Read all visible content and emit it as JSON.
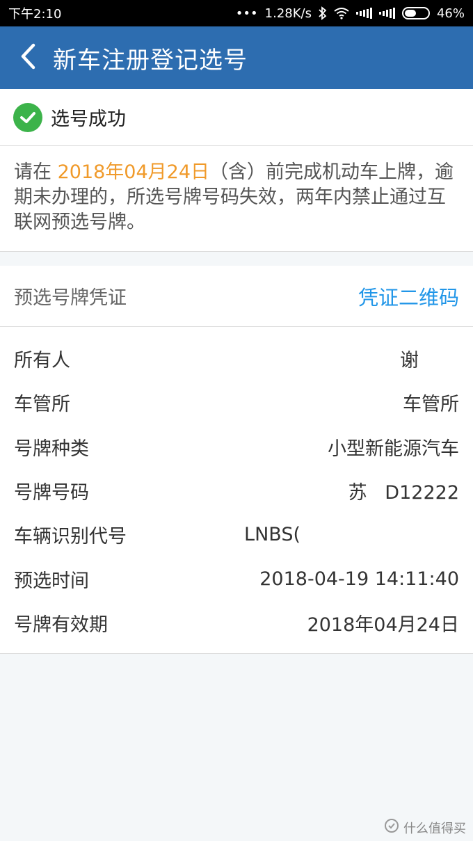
{
  "status_bar": {
    "time": "下午2:10",
    "dots": "•••",
    "speed": "1.28K/s",
    "battery_percent": "46%"
  },
  "app_bar": {
    "title": "新车注册登记选号"
  },
  "success": {
    "text": "选号成功"
  },
  "notice": {
    "prefix": "请在 ",
    "date": "2018年04月24日",
    "suffix": "（含）前完成机动车上牌，逾期未办理的，所选号牌号码失效，两年内禁止通过互联网预选号牌。"
  },
  "voucher": {
    "title": "预选号牌凭证",
    "qr_link": "凭证二维码"
  },
  "info_rows": [
    {
      "label": "所有人",
      "value": "谢"
    },
    {
      "label": "车管所",
      "value": "车管所"
    },
    {
      "label": "号牌种类",
      "value": "小型新能源汽车"
    },
    {
      "label": "号牌号码",
      "value": "苏   D12222"
    },
    {
      "label": "车辆识别代号",
      "value": "LNBS("
    },
    {
      "label": "预选时间",
      "value": "2018-04-19 14:11:40"
    },
    {
      "label": "号牌有效期",
      "value": "2018年04月24日"
    }
  ],
  "watermark": {
    "text": "什么值得买"
  },
  "colors": {
    "app_bar": "#2d6db0",
    "success": "#3cb34a",
    "date_highlight": "#f09a2a",
    "link": "#2196e8"
  }
}
